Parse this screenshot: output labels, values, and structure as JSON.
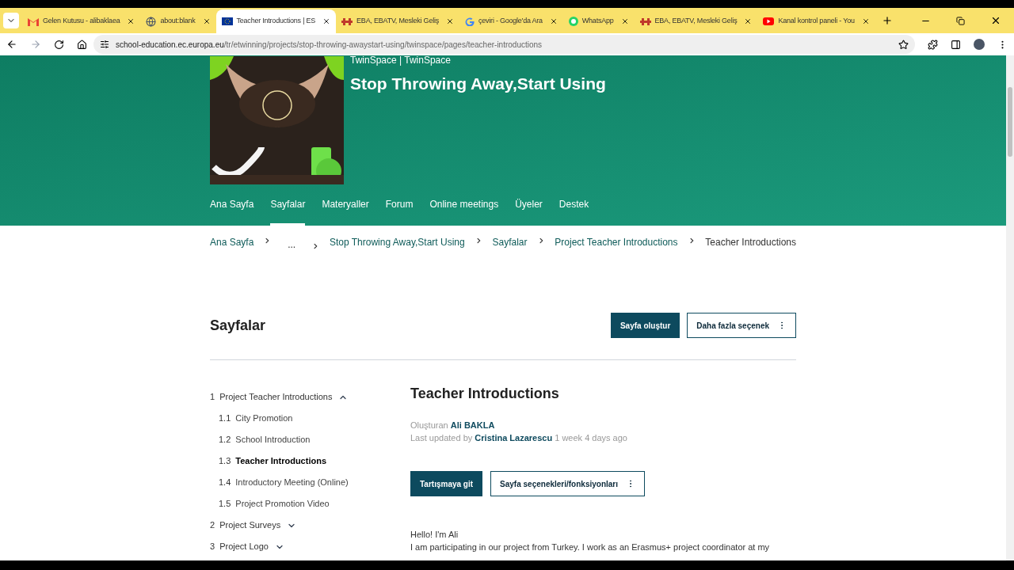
{
  "browser": {
    "tabs": [
      {
        "title": "Gelen Kutusu - alibaklaea",
        "kind": "mail",
        "selected": false
      },
      {
        "title": "about:blank",
        "kind": "globe",
        "selected": false
      },
      {
        "title": "Teacher Introductions | ES",
        "kind": "flag",
        "selected": true
      },
      {
        "title": "EBA, EBATV, Mesleki Geliş",
        "kind": "eba",
        "selected": false
      },
      {
        "title": "çeviri - Google'da Ara",
        "kind": "google",
        "selected": false
      },
      {
        "title": "WhatsApp",
        "kind": "whatsapp",
        "selected": false
      },
      {
        "title": "EBA, EBATV, Mesleki Geliş",
        "kind": "eba",
        "selected": false
      },
      {
        "title": "Kanal kontrol paneli - You",
        "kind": "youtube",
        "selected": false
      }
    ],
    "url_host": "school-education.ec.europa.eu",
    "url_path": "/tr/etwinning/projects/stop-throwing-awaystart-using/twinspace/pages/teacher-introductions"
  },
  "header": {
    "kicker": "TwinSpace | TwinSpace",
    "title": "Stop Throwing Away,Start Using"
  },
  "nav": [
    {
      "label": "Ana Sayfa",
      "selected": false
    },
    {
      "label": "Sayfalar",
      "selected": true
    },
    {
      "label": "Materyaller",
      "selected": false
    },
    {
      "label": "Forum",
      "selected": false
    },
    {
      "label": "Online meetings",
      "selected": false
    },
    {
      "label": "Üyeler",
      "selected": false
    },
    {
      "label": "Destek",
      "selected": false
    }
  ],
  "breadcrumb": [
    {
      "label": "Ana Sayfa",
      "kind": "link"
    },
    {
      "label": "...",
      "kind": "ellipsis"
    },
    {
      "label": "Stop Throwing Away,Start Using",
      "kind": "link"
    },
    {
      "label": "Sayfalar",
      "kind": "link"
    },
    {
      "label": "Project Teacher Introductions",
      "kind": "link"
    },
    {
      "label": "Teacher Introductions",
      "kind": "current"
    }
  ],
  "section": {
    "title": "Sayfalar",
    "primary_button": "Sayfa oluştur",
    "more_button": "Daha fazla seçenek"
  },
  "tree": [
    {
      "number": "1",
      "title": "Project Teacher Introductions",
      "expanded": true,
      "selected": false,
      "children": [
        {
          "number": "1.1",
          "title": "City Promotion",
          "selected": false
        },
        {
          "number": "1.2",
          "title": "School Introduction",
          "selected": false
        },
        {
          "number": "1.3",
          "title": "Teacher Introductions",
          "selected": true
        },
        {
          "number": "1.4",
          "title": "Introductory Meeting (Online)",
          "selected": false
        },
        {
          "number": "1.5",
          "title": "Project Promotion Video",
          "selected": false
        }
      ]
    },
    {
      "number": "2",
      "title": "Project Surveys",
      "expanded": false,
      "selected": false
    },
    {
      "number": "3",
      "title": "Project Logo",
      "expanded": false,
      "selected": false
    }
  ],
  "page": {
    "title": "Teacher Introductions",
    "created_label": "Oluşturan",
    "created_by": "Ali BAKLA",
    "updated_label": "Last updated by",
    "updated_by": "Cristina Lazarescu",
    "updated_ago": "1 week 4 days ago",
    "discuss_button": "Tartışmaya git",
    "options_button": "Sayfa seçenekleri/fonksiyonları",
    "body": [
      "Hello! I'm Ali",
      "I am participating in our project from Turkey. I work as an Erasmus+ project coordinator at my"
    ]
  }
}
